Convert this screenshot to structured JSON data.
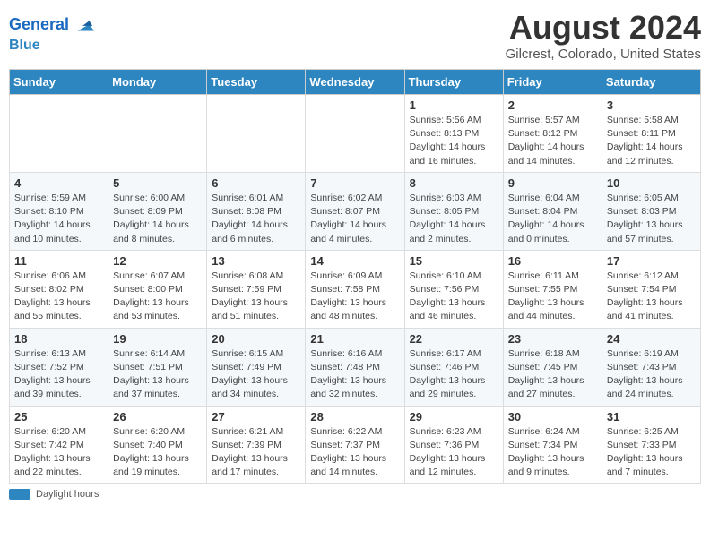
{
  "header": {
    "logo_line1": "General",
    "logo_line2": "Blue",
    "month_year": "August 2024",
    "location": "Gilcrest, Colorado, United States"
  },
  "days_of_week": [
    "Sunday",
    "Monday",
    "Tuesday",
    "Wednesday",
    "Thursday",
    "Friday",
    "Saturday"
  ],
  "weeks": [
    [
      {
        "day": "",
        "info": ""
      },
      {
        "day": "",
        "info": ""
      },
      {
        "day": "",
        "info": ""
      },
      {
        "day": "",
        "info": ""
      },
      {
        "day": "1",
        "info": "Sunrise: 5:56 AM\nSunset: 8:13 PM\nDaylight: 14 hours and 16 minutes."
      },
      {
        "day": "2",
        "info": "Sunrise: 5:57 AM\nSunset: 8:12 PM\nDaylight: 14 hours and 14 minutes."
      },
      {
        "day": "3",
        "info": "Sunrise: 5:58 AM\nSunset: 8:11 PM\nDaylight: 14 hours and 12 minutes."
      }
    ],
    [
      {
        "day": "4",
        "info": "Sunrise: 5:59 AM\nSunset: 8:10 PM\nDaylight: 14 hours and 10 minutes."
      },
      {
        "day": "5",
        "info": "Sunrise: 6:00 AM\nSunset: 8:09 PM\nDaylight: 14 hours and 8 minutes."
      },
      {
        "day": "6",
        "info": "Sunrise: 6:01 AM\nSunset: 8:08 PM\nDaylight: 14 hours and 6 minutes."
      },
      {
        "day": "7",
        "info": "Sunrise: 6:02 AM\nSunset: 8:07 PM\nDaylight: 14 hours and 4 minutes."
      },
      {
        "day": "8",
        "info": "Sunrise: 6:03 AM\nSunset: 8:05 PM\nDaylight: 14 hours and 2 minutes."
      },
      {
        "day": "9",
        "info": "Sunrise: 6:04 AM\nSunset: 8:04 PM\nDaylight: 14 hours and 0 minutes."
      },
      {
        "day": "10",
        "info": "Sunrise: 6:05 AM\nSunset: 8:03 PM\nDaylight: 13 hours and 57 minutes."
      }
    ],
    [
      {
        "day": "11",
        "info": "Sunrise: 6:06 AM\nSunset: 8:02 PM\nDaylight: 13 hours and 55 minutes."
      },
      {
        "day": "12",
        "info": "Sunrise: 6:07 AM\nSunset: 8:00 PM\nDaylight: 13 hours and 53 minutes."
      },
      {
        "day": "13",
        "info": "Sunrise: 6:08 AM\nSunset: 7:59 PM\nDaylight: 13 hours and 51 minutes."
      },
      {
        "day": "14",
        "info": "Sunrise: 6:09 AM\nSunset: 7:58 PM\nDaylight: 13 hours and 48 minutes."
      },
      {
        "day": "15",
        "info": "Sunrise: 6:10 AM\nSunset: 7:56 PM\nDaylight: 13 hours and 46 minutes."
      },
      {
        "day": "16",
        "info": "Sunrise: 6:11 AM\nSunset: 7:55 PM\nDaylight: 13 hours and 44 minutes."
      },
      {
        "day": "17",
        "info": "Sunrise: 6:12 AM\nSunset: 7:54 PM\nDaylight: 13 hours and 41 minutes."
      }
    ],
    [
      {
        "day": "18",
        "info": "Sunrise: 6:13 AM\nSunset: 7:52 PM\nDaylight: 13 hours and 39 minutes."
      },
      {
        "day": "19",
        "info": "Sunrise: 6:14 AM\nSunset: 7:51 PM\nDaylight: 13 hours and 37 minutes."
      },
      {
        "day": "20",
        "info": "Sunrise: 6:15 AM\nSunset: 7:49 PM\nDaylight: 13 hours and 34 minutes."
      },
      {
        "day": "21",
        "info": "Sunrise: 6:16 AM\nSunset: 7:48 PM\nDaylight: 13 hours and 32 minutes."
      },
      {
        "day": "22",
        "info": "Sunrise: 6:17 AM\nSunset: 7:46 PM\nDaylight: 13 hours and 29 minutes."
      },
      {
        "day": "23",
        "info": "Sunrise: 6:18 AM\nSunset: 7:45 PM\nDaylight: 13 hours and 27 minutes."
      },
      {
        "day": "24",
        "info": "Sunrise: 6:19 AM\nSunset: 7:43 PM\nDaylight: 13 hours and 24 minutes."
      }
    ],
    [
      {
        "day": "25",
        "info": "Sunrise: 6:20 AM\nSunset: 7:42 PM\nDaylight: 13 hours and 22 minutes."
      },
      {
        "day": "26",
        "info": "Sunrise: 6:20 AM\nSunset: 7:40 PM\nDaylight: 13 hours and 19 minutes."
      },
      {
        "day": "27",
        "info": "Sunrise: 6:21 AM\nSunset: 7:39 PM\nDaylight: 13 hours and 17 minutes."
      },
      {
        "day": "28",
        "info": "Sunrise: 6:22 AM\nSunset: 7:37 PM\nDaylight: 13 hours and 14 minutes."
      },
      {
        "day": "29",
        "info": "Sunrise: 6:23 AM\nSunset: 7:36 PM\nDaylight: 13 hours and 12 minutes."
      },
      {
        "day": "30",
        "info": "Sunrise: 6:24 AM\nSunset: 7:34 PM\nDaylight: 13 hours and 9 minutes."
      },
      {
        "day": "31",
        "info": "Sunrise: 6:25 AM\nSunset: 7:33 PM\nDaylight: 13 hours and 7 minutes."
      }
    ]
  ],
  "footer": {
    "daylight_label": "Daylight hours"
  }
}
